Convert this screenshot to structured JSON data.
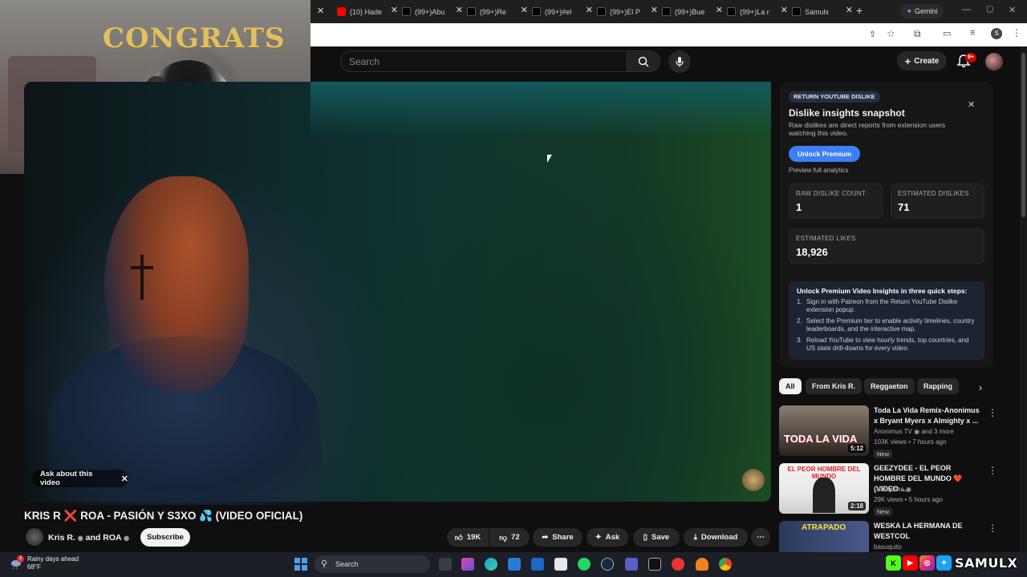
{
  "browser": {
    "tabs": [
      {
        "label": "(10) Hade",
        "color": "#ff0000"
      },
      {
        "label": "(99+)Abu",
        "color": "#000000"
      },
      {
        "label": "(99+)Re",
        "color": "#000000"
      },
      {
        "label": "(99+)#el",
        "color": "#000000"
      },
      {
        "label": "(99+)El P",
        "color": "#000000"
      },
      {
        "label": "(99+)Bue",
        "color": "#000000"
      },
      {
        "label": "(99+)La r",
        "color": "#000000"
      },
      {
        "label": "Samulx",
        "color": "#000000"
      }
    ],
    "gemini_label": "Gemini",
    "profile_initial": "S"
  },
  "webcam": {
    "banner": "CONGRATS"
  },
  "header": {
    "search_placeholder": "Search",
    "create_label": "Create",
    "notifications_badge": "9+"
  },
  "video": {
    "ask_label": "Ask about this video",
    "title": "KRIS R ❌ ROA - PASIÓN Y S3XO 💦 (VIDEO OFICIAL)",
    "channel": "Kris R.",
    "channel_and": "and ROA",
    "subscribe_label": "Subscribe",
    "likes": "19K",
    "dislikes": "72",
    "share_label": "Share",
    "ask_btn_label": "Ask",
    "save_label": "Save",
    "download_label": "Download"
  },
  "panel": {
    "badge": "RETURN YOUTUBE DISLIKE",
    "title": "Dislike insights snapshot",
    "description": "Raw dislikes are direct reports from extension users watching this video.",
    "unlock_label": "Unlock Premium",
    "preview_label": "Preview full analytics",
    "raw_dislike_label": "RAW DISLIKE COUNT",
    "raw_dislike_value": "1",
    "estimated_dislikes_label": "ESTIMATED DISLIKES",
    "estimated_dislikes_value": "71",
    "estimated_likes_label": "ESTIMATED LIKES",
    "estimated_likes_value": "18,926",
    "steps_title": "Unlock Premium Video Insights in three quick steps:",
    "steps": [
      "Sign in with Patreon from the Return YouTube Dislike extension popup.",
      "Select the Premium tier to enable activity timelines, country leaderboards, and the interactive map.",
      "Reload YouTube to view hourly trends, top countries, and US state drill-downs for every video."
    ]
  },
  "chips": [
    "All",
    "From Kris R.",
    "Reggaeton",
    "Rapping"
  ],
  "recommendations": [
    {
      "title": "Toda La Vida Remix-Anonimus x Bryant Myers x Almighty x ...",
      "channel": "Anonimus TV",
      "channel_extra": "and 3 more",
      "meta": "103K views • 7 hours ago",
      "badge": "New",
      "duration": "5:12",
      "thumb_text": "TODA LA VIDA"
    },
    {
      "title": "GEEZYDEE - EL PEOR HOMBRE DEL MUNDO ❤️ (VIDEO ...",
      "channel": "GeezyDee",
      "channel_extra": "",
      "meta": "29K views • 5 hours ago",
      "badge": "New",
      "duration": "2:18",
      "thumb_text": "EL PEOR HOMBRE DEL MUNDO"
    },
    {
      "title": "WESKA LA HERMANA DE WESTCOL",
      "channel": "basuquito",
      "channel_extra": "",
      "meta": "",
      "badge": "",
      "duration": "",
      "thumb_text": "ATRAPADO"
    }
  ],
  "taskbar": {
    "weather_title": "Rainy days ahead",
    "weather_temp": "68°F",
    "weather_badge": "3",
    "search_label": "Search",
    "brand": "SAMULX"
  },
  "colors": {
    "accent": "#3d7ff5",
    "yt_red": "#ff0000",
    "panel_bg": "#161616"
  }
}
